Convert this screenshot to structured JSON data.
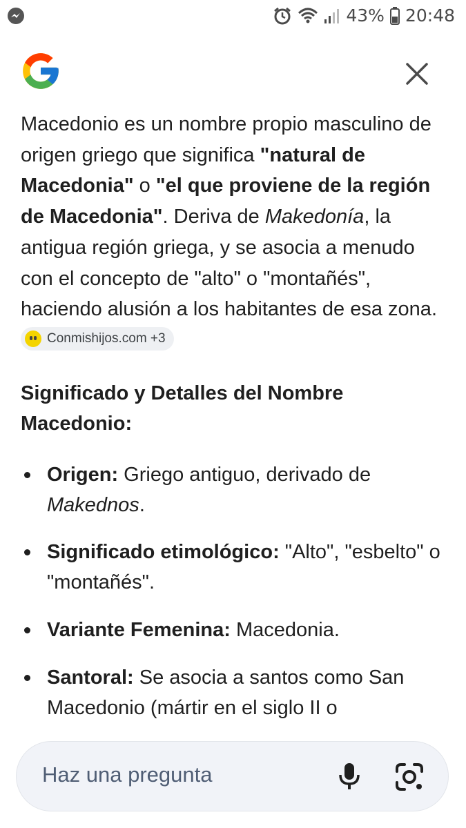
{
  "status_bar": {
    "battery_percent": "43%",
    "time": "20:48",
    "icons": [
      "messenger-icon",
      "alarm-icon",
      "wifi-icon",
      "signal-icon",
      "battery-icon"
    ]
  },
  "header": {
    "logo": "google-g-logo",
    "close_icon": "close-icon"
  },
  "answer": {
    "p1": "Macedonio es un nombre propio masculino de origen griego que significa ",
    "b1": "\"natural de Macedonia\"",
    "p2": " o ",
    "b2": "\"el que proviene de la región de Macedonia\"",
    "p3": ". Deriva de ",
    "i1": "Makedonía",
    "p4": ", la antigua región griega, y se asocia a menudo con el concepto de \"alto\" o \"montañés\", haciendo alusión a los habitantes de esa zona.",
    "source_chip": "Conmishijos.com +3"
  },
  "section_title": "Significado y Detalles del Nombre Macedonio:",
  "details": [
    {
      "label": "Origen:",
      "text": " Griego antiguo, derivado de ",
      "italic": "Makednos",
      "tail": "."
    },
    {
      "label": "Significado etimológico:",
      "text": " \"Alto\", \"esbelto\" o \"montañés\".",
      "italic": "",
      "tail": ""
    },
    {
      "label": "Variante Femenina:",
      "text": " Macedonia.",
      "italic": "",
      "tail": ""
    },
    {
      "label": "Santoral:",
      "text": " Se asocia a santos como San Macedonio (mártir en el siglo II o",
      "italic": "",
      "tail": ""
    }
  ],
  "ask_bar": {
    "placeholder": "Haz una pregunta",
    "mic_icon": "mic-icon",
    "lens_icon": "google-lens-icon"
  },
  "colors": {
    "text": "#1f1f1f",
    "ask_bar_bg": "#f1f3f8",
    "placeholder": "#4f5d74",
    "chip_bg": "#eef0f3"
  }
}
